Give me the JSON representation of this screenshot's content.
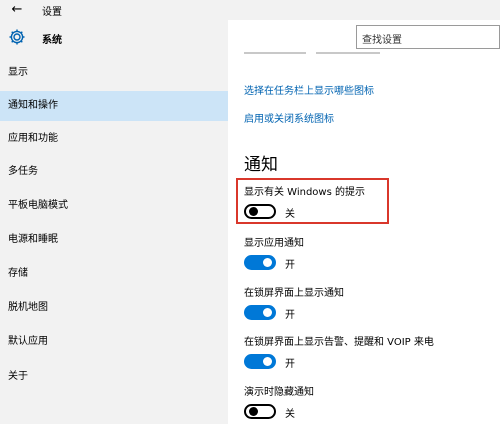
{
  "window": {
    "title": "设置",
    "back_icon": "←"
  },
  "sidebar": {
    "header": "系统",
    "items": [
      {
        "label": "显示",
        "active": false
      },
      {
        "label": "通知和操作",
        "active": true
      },
      {
        "label": "应用和功能",
        "active": false
      },
      {
        "label": "多任务",
        "active": false
      },
      {
        "label": "平板电脑模式",
        "active": false
      },
      {
        "label": "电源和睡眠",
        "active": false
      },
      {
        "label": "存储",
        "active": false
      },
      {
        "label": "脱机地图",
        "active": false
      },
      {
        "label": "默认应用",
        "active": false
      },
      {
        "label": "关于",
        "active": false
      }
    ]
  },
  "search": {
    "placeholder": "查找设置"
  },
  "links": {
    "taskbar_icons": "选择在任务栏上显示哪些图标",
    "system_icons": "启用或关闭系统图标"
  },
  "section": {
    "title": "通知"
  },
  "settings": [
    {
      "label": "显示有关 Windows 的提示",
      "state": "关",
      "on": false
    },
    {
      "label": "显示应用通知",
      "state": "开",
      "on": true
    },
    {
      "label": "在锁屏界面上显示通知",
      "state": "开",
      "on": true
    },
    {
      "label": "在锁屏界面上显示告警、提醒和 VOIP 来电",
      "state": "开",
      "on": true
    },
    {
      "label": "演示时隐藏通知",
      "state": "关",
      "on": false
    }
  ],
  "colors": {
    "accent": "#0078d7",
    "link": "#0063b1",
    "highlight": "#d9372b",
    "sidebar_active": "#cce4f7"
  }
}
